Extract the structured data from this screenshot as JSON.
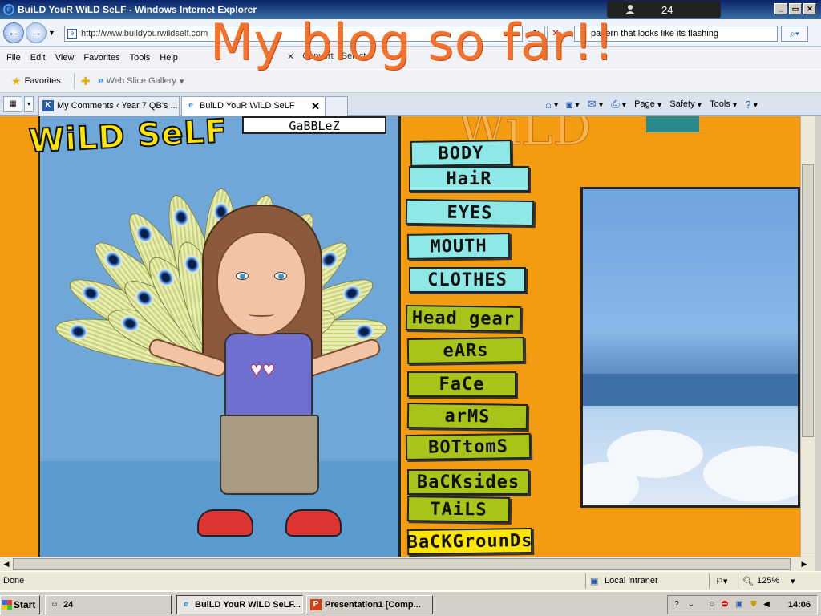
{
  "window": {
    "title": "BuiLD YouR WiLD SeLF - Windows Internet Explorer",
    "controls": [
      "_",
      "▭",
      "✕"
    ]
  },
  "user_badge": {
    "count": "24"
  },
  "address": {
    "url": "http://www.buildyourwildself.com",
    "search_value": "pattern that looks like its flashing"
  },
  "menu": [
    "File",
    "Edit",
    "View",
    "Favorites",
    "Tools",
    "Help"
  ],
  "menu_extra": {
    "convert": "Convert",
    "select": "Select"
  },
  "favorites": {
    "favorites_label": "Favorites",
    "web_slice_label": "Web Slice Gallery"
  },
  "tabs": [
    {
      "label": "My Comments ‹ Year 7 QB's ...",
      "icon": "K"
    },
    {
      "label": "BuiLD YouR WiLD SeLF",
      "icon": "e"
    }
  ],
  "command_bar": {
    "page": "Page",
    "safety": "Safety",
    "tools": "Tools"
  },
  "content": {
    "logo": "WiLD SeLF",
    "name_tag": "GaBBLeZ",
    "bg_word": "WiLD",
    "menu_items": [
      "BODY",
      "HaiR",
      "EYES",
      "MOUTH",
      "CLOTHES",
      "Head gear",
      "eARs",
      "FaCe",
      "arMS",
      "BOTtomS",
      "BaCKsides",
      "TAiLS",
      "BaCKGrounDs"
    ]
  },
  "status": {
    "left": "Done",
    "zone": "Local intranet",
    "zoom": "125%"
  },
  "taskbar": {
    "start": "Start",
    "tasks": [
      "24",
      "BuiLD YouR WiLD SeLF...",
      "Presentation1 [Comp..."
    ],
    "clock": "14:06"
  },
  "overlay_text": "My blog so far!!",
  "colors": {
    "overlay": "#f4722b",
    "page_bg": "#f39c12",
    "strip_cyan": "#8ee8e6",
    "strip_green": "#a8c418",
    "strip_yellow": "#ffe600"
  }
}
